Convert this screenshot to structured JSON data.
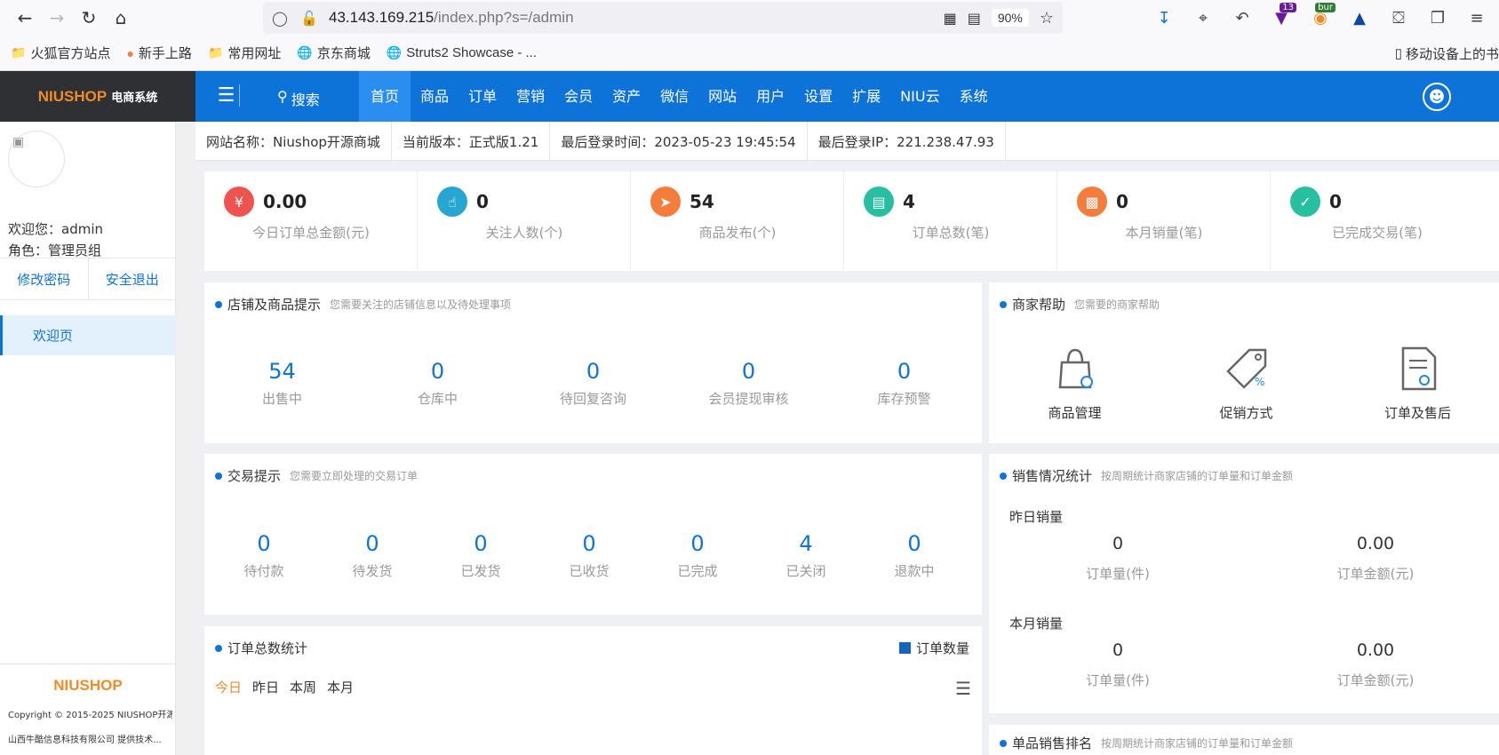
{
  "browser": {
    "url_host": "43.143.169.215",
    "url_path": "/index.php?s=/admin",
    "zoom": "90%",
    "badge_count": "13",
    "badge_bur": "bur",
    "bookmarks": [
      "火狐官方站点",
      "新手上路",
      "常用网址",
      "京东商城",
      "Struts2 Showcase - ..."
    ],
    "bookmark_right": "移动设备上的书"
  },
  "header": {
    "brand": "NIUSHOP",
    "brand_sub": "电商系统",
    "search_label": "搜索",
    "nav": [
      "首页",
      "商品",
      "订单",
      "营销",
      "会员",
      "资产",
      "微信",
      "网站",
      "用户",
      "设置",
      "扩展",
      "NIU云",
      "系统"
    ]
  },
  "sidebar": {
    "welcome": "欢迎您：admin",
    "role": "角色：管理员组",
    "change_password": "修改密码",
    "logout": "安全退出",
    "menu_item": "欢迎页",
    "footer_brand": "NIUSHOP",
    "copyright": "Copyright © 2015-2025 NIUSHOP开源...",
    "provider": "山西牛酷信息科技有限公司 提供技术..."
  },
  "info_bar": [
    "网站名称：Niushop开源商城",
    "当前版本：正式版1.21",
    "最后登录时间：2023-05-23 19:45:54",
    "最后登录IP：221.238.47.93"
  ],
  "stats": [
    {
      "value": "0.00",
      "label": "今日订单总金额(元)",
      "color": "#ef5350",
      "icon": "money-bag-icon"
    },
    {
      "value": "0",
      "label": "关注人数(个)",
      "color": "#26a6d1",
      "icon": "thumbs-up-icon"
    },
    {
      "value": "54",
      "label": "商品发布(个)",
      "color": "#f57c3a",
      "icon": "paper-plane-icon"
    },
    {
      "value": "4",
      "label": "订单总数(笔)",
      "color": "#26c0a0",
      "icon": "clipboard-icon"
    },
    {
      "value": "0",
      "label": "本月销量(笔)",
      "color": "#f57c3a",
      "icon": "bar-chart-icon"
    },
    {
      "value": "0",
      "label": "已完成交易(笔)",
      "color": "#26c0a0",
      "icon": "checked-document-icon"
    }
  ],
  "store_panel": {
    "title": "店铺及商品提示",
    "subtitle": "您需要关注的店铺信息以及待处理事项",
    "items": [
      {
        "value": "54",
        "label": "出售中"
      },
      {
        "value": "0",
        "label": "仓库中"
      },
      {
        "value": "0",
        "label": "待回复咨询"
      },
      {
        "value": "0",
        "label": "会员提现审核"
      },
      {
        "value": "0",
        "label": "库存预警"
      }
    ]
  },
  "trade_panel": {
    "title": "交易提示",
    "subtitle": "您需要立即处理的交易订单",
    "items": [
      {
        "value": "0",
        "label": "待付款"
      },
      {
        "value": "0",
        "label": "待发货"
      },
      {
        "value": "0",
        "label": "已发货"
      },
      {
        "value": "0",
        "label": "已收货"
      },
      {
        "value": "0",
        "label": "已完成"
      },
      {
        "value": "4",
        "label": "已关闭"
      },
      {
        "value": "0",
        "label": "退款中"
      }
    ]
  },
  "order_chart": {
    "title": "订单总数统计",
    "legend": "订单数量",
    "tabs": [
      "今日",
      "昨日",
      "本周",
      "本月"
    ]
  },
  "help_panel": {
    "title": "商家帮助",
    "subtitle": "您需要的商家帮助",
    "items": [
      "商品管理",
      "促销方式",
      "订单及售后"
    ]
  },
  "sales_panel": {
    "title": "销售情况统计",
    "subtitle": "按周期统计商家店铺的订单量和订单金额",
    "yesterday_label": "昨日销量",
    "month_label": "本月销量",
    "yesterday": [
      {
        "value": "0",
        "label": "订单量(件)"
      },
      {
        "value": "0.00",
        "label": "订单金额(元)"
      }
    ],
    "month": [
      {
        "value": "0",
        "label": "订单量(件)"
      },
      {
        "value": "0.00",
        "label": "订单金额(元)"
      }
    ]
  },
  "ranking_panel": {
    "title": "单品销售排名",
    "subtitle": "按周期统计商家店铺的订单量和订单金额"
  }
}
